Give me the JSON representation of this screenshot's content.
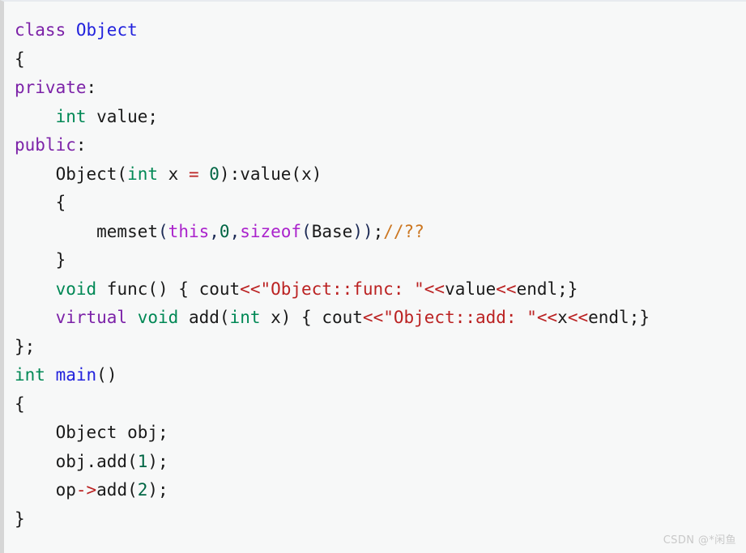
{
  "editor": {
    "language": "cpp",
    "background_color": "#f7f8f8",
    "left_border_color": "#d6d6d6",
    "top_border_color": "#e8ebef",
    "font_size_px": 21,
    "line_height_px": 35.5,
    "indent_spaces": 4,
    "total_lines": 17
  },
  "theme": {
    "keyword": "#7c22a8",
    "type": "#008855",
    "class_name": "#2222dd",
    "plain": "#1a1a1a",
    "number": "#006644",
    "string": "#bb2222",
    "operator": "#bb2222",
    "punctuation": "#1c2a55",
    "builtin": "#aa22cc",
    "comment": "#cc7722"
  },
  "code": {
    "full_text": "class Object\n{\nprivate:\n    int value;\npublic:\n    Object(int x = 0):value(x)\n    {\n        memset(this,0,sizeof(Base));//??\n    }\n    void func() { cout<<\"Object::func: \"<<value<<endl;}\n    virtual void add(int x) { cout<<\"Object::add: \"<<x<<endl;}\n};\nint main()\n{\n    Object obj;\n    obj.add(1);\n    op->add(2);\n}",
    "lines": [
      {
        "n": 1,
        "text": "class Object"
      },
      {
        "n": 2,
        "text": "{"
      },
      {
        "n": 3,
        "text": "private:"
      },
      {
        "n": 4,
        "text": "    int value;"
      },
      {
        "n": 5,
        "text": "public:"
      },
      {
        "n": 6,
        "text": "    Object(int x = 0):value(x)"
      },
      {
        "n": 7,
        "text": "    {"
      },
      {
        "n": 8,
        "text": "        memset(this,0,sizeof(Base));//??"
      },
      {
        "n": 9,
        "text": "    }"
      },
      {
        "n": 10,
        "text": "    void func() { cout<<\"Object::func: \"<<value<<endl;}"
      },
      {
        "n": 11,
        "text": "    virtual void add(int x) { cout<<\"Object::add: \"<<x<<endl;}"
      },
      {
        "n": 12,
        "text": "};"
      },
      {
        "n": 13,
        "text": "int main()"
      },
      {
        "n": 14,
        "text": "{"
      },
      {
        "n": 15,
        "text": "    Object obj;"
      },
      {
        "n": 16,
        "text": "    obj.add(1);"
      },
      {
        "n": 17,
        "text": "    op->add(2);"
      },
      {
        "n": 18,
        "text": "}"
      }
    ],
    "tokens": {
      "keywords": [
        "class",
        "private",
        "public",
        "virtual"
      ],
      "types": [
        "int",
        "void"
      ],
      "class_names": [
        "Object",
        "main"
      ],
      "builtins": [
        "this",
        "sizeof"
      ],
      "identifiers": [
        "value",
        "x",
        "memset",
        "Base",
        "func",
        "cout",
        "endl",
        "add",
        "obj",
        "op"
      ],
      "strings": [
        "\"Object::func: \"",
        "\"Object::add: \""
      ],
      "numbers": [
        "0",
        "1",
        "2"
      ],
      "operators": [
        "=",
        "<<",
        "->"
      ],
      "comments": [
        "//??"
      ]
    }
  },
  "watermark": {
    "text": "CSDN @*闲鱼",
    "color": "#c9c9c9"
  }
}
